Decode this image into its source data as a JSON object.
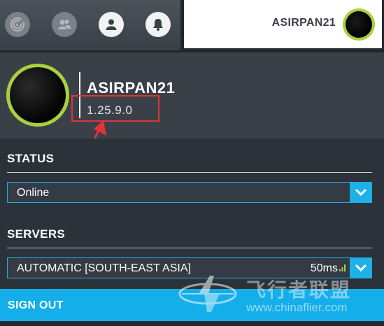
{
  "colors": {
    "accent": "#1fb0e8",
    "signout_bg": "#14aeea",
    "avatar_ring": "#a9d13d",
    "highlight_box": "#e23434",
    "panel_bg": "#2c323a",
    "header_bg": "#3a4048",
    "signal": "#a9d13d"
  },
  "topbar": {
    "icons": [
      {
        "name": "radar-icon"
      },
      {
        "name": "friends-icon"
      },
      {
        "name": "user-icon"
      },
      {
        "name": "bell-icon"
      }
    ],
    "profile_tab": {
      "username": "ASIRPAN21"
    }
  },
  "header": {
    "username": "ASIRPAN21",
    "version": "1.25.9.0"
  },
  "status": {
    "title": "STATUS",
    "selected": "Online"
  },
  "servers": {
    "title": "SERVERS",
    "selected": "AUTOMATIC [SOUTH-EAST ASIA]",
    "ping": "50ms",
    "signal_icon": "signal-bars-icon"
  },
  "signout": {
    "label": "SIGN OUT"
  },
  "watermark": {
    "title": "飞行者联盟",
    "url": "www.chinaflier.com"
  }
}
